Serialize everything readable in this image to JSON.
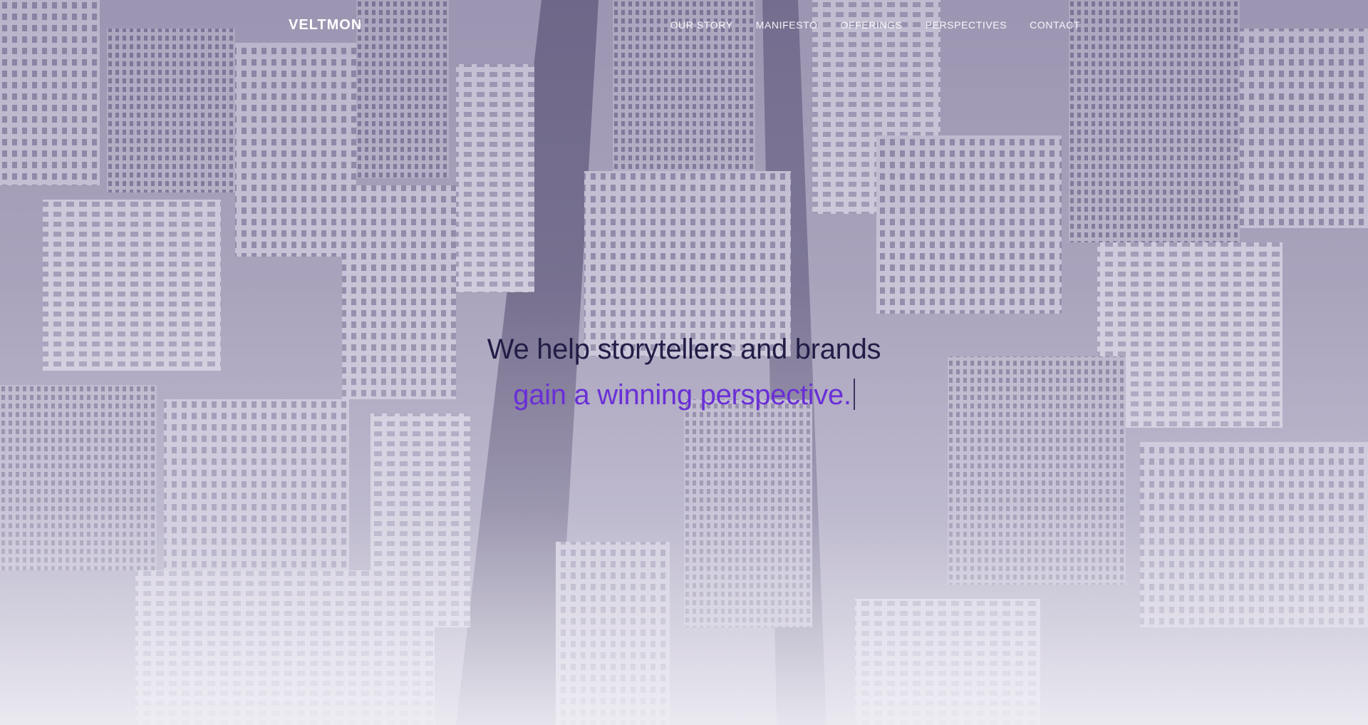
{
  "nav": {
    "logo": "VELTMON",
    "links": [
      "OUR STORY",
      "MANIFESTO",
      "OFFERINGS",
      "PERSPECTIVES",
      "CONTACT"
    ]
  },
  "hero": {
    "headline_line1": "We help storytellers and brands",
    "headline_line2": "gain a winning perspective."
  },
  "colors": {
    "headline_dark": "#221d46",
    "headline_accent": "#6a2fd6",
    "nav_text": "#ffffff"
  }
}
